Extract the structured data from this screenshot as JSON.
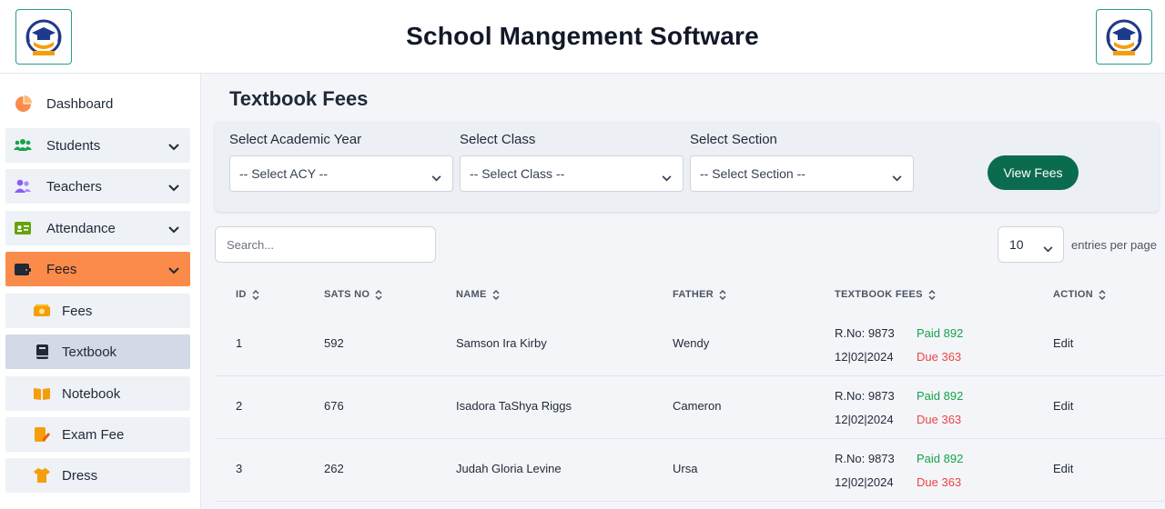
{
  "header": {
    "title": "School Mangement Software"
  },
  "sidebar": {
    "items": [
      {
        "label": "Dashboard"
      },
      {
        "label": "Students"
      },
      {
        "label": "Teachers"
      },
      {
        "label": "Attendance"
      },
      {
        "label": "Fees"
      }
    ],
    "fees_sub": [
      {
        "label": "Fees"
      },
      {
        "label": "Textbook"
      },
      {
        "label": "Notebook"
      },
      {
        "label": "Exam Fee"
      },
      {
        "label": "Dress"
      }
    ]
  },
  "page": {
    "title": "Textbook Fees"
  },
  "filters": {
    "academic_year": {
      "label": "Select Academic Year",
      "value": "-- Select ACY --"
    },
    "class": {
      "label": "Select Class",
      "value": "-- Select Class --"
    },
    "section": {
      "label": "Select Section",
      "value": "-- Select Section --"
    },
    "view_button": "View Fees"
  },
  "table_controls": {
    "search_placeholder": "Search...",
    "entries_value": "10",
    "entries_label": "entries per page"
  },
  "table": {
    "columns": [
      "ID",
      "SATS NO",
      "NAME",
      "FATHER",
      "TEXTBOOK FEES",
      "ACTION"
    ],
    "rows": [
      {
        "id": "1",
        "sats": "592",
        "name": "Samson Ira Kirby",
        "father": "Wendy",
        "rno": "R.No: 9873",
        "date": "12|02|2024",
        "paid": "Paid 892",
        "due": "Due 363",
        "action": "Edit"
      },
      {
        "id": "2",
        "sats": "676",
        "name": "Isadora TaShya Riggs",
        "father": "Cameron",
        "rno": "R.No: 9873",
        "date": "12|02|2024",
        "paid": "Paid 892",
        "due": "Due 363",
        "action": "Edit"
      },
      {
        "id": "3",
        "sats": "262",
        "name": "Judah Gloria Levine",
        "father": "Ursa",
        "rno": "R.No: 9873",
        "date": "12|02|2024",
        "paid": "Paid 892",
        "due": "Due 363",
        "action": "Edit"
      }
    ]
  },
  "colors": {
    "accent": "#fb8b4a",
    "primary_button": "#0b6b4f",
    "paid": "#16a34a",
    "due": "#ef4444"
  },
  "icons": {
    "logo": "school-graduation-logo",
    "dashboard": "pie-chart-icon",
    "students": "users-icon",
    "teachers": "user-group-icon",
    "attendance": "id-card-icon",
    "fees": "wallet-icon",
    "sort": "sort-icon",
    "chevron": "chevron-down-icon"
  }
}
